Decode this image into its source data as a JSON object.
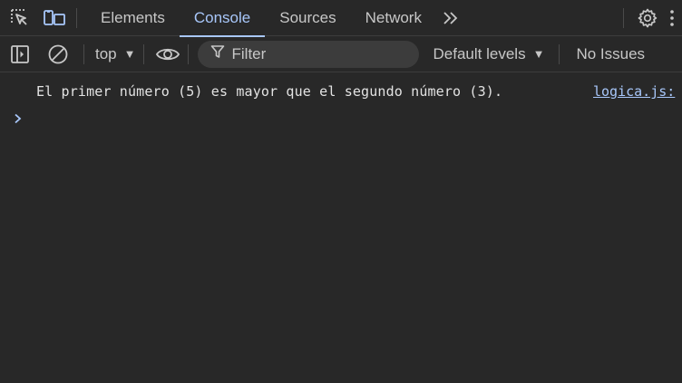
{
  "tabs": [
    {
      "label": "Elements"
    },
    {
      "label": "Console"
    },
    {
      "label": "Sources"
    },
    {
      "label": "Network"
    }
  ],
  "toolbar": {
    "context": "top",
    "filter_placeholder": "Filter",
    "levels": "Default levels",
    "issues": "No Issues"
  },
  "console": {
    "messages": [
      {
        "text": "El primer número (5) es mayor que el segundo número (3).",
        "source": "logica.js:"
      }
    ]
  },
  "colors": {
    "background": "#282828",
    "accent": "#a8c7fa",
    "text": "#e3e3e3"
  },
  "icons": [
    "inspect-element-icon",
    "device-toggle-icon",
    "more-tabs-icon",
    "settings-gear-icon",
    "kebab-menu-icon",
    "sidebar-toggle-icon",
    "clear-console-icon",
    "live-expression-eye-icon",
    "filter-funnel-icon",
    "prompt-chevron-icon"
  ]
}
